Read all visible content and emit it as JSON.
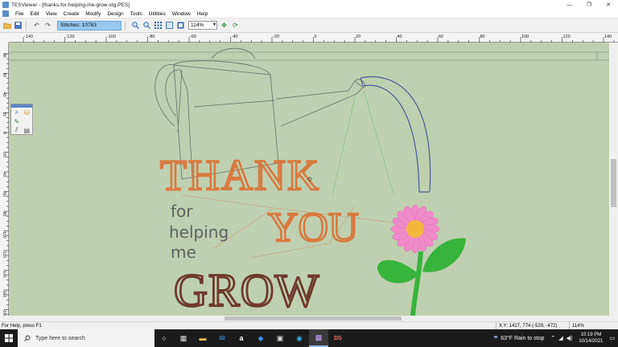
{
  "window": {
    "title": "TESViewer - [thanks-for-helping-me-grow-xtg.PES]",
    "controls": [
      "—",
      "❐",
      "✕"
    ]
  },
  "menu": [
    "File",
    "Edit",
    "View",
    "Create",
    "Modify",
    "Design",
    "Tools",
    "Utilities",
    "Window",
    "Help"
  ],
  "toolbar": {
    "stitches": "Stitches: 10783",
    "zoom": "114%"
  },
  "rulers": {
    "h_ticks": [
      "-140",
      "-120",
      "-100",
      "-80",
      "-60",
      "-40",
      "-20",
      "0",
      "20",
      "40",
      "60",
      "80",
      "100",
      "120",
      "140"
    ],
    "v_ticks": [
      "80",
      "60",
      "40",
      "20",
      "0",
      "-20",
      "-40",
      "-60",
      "-80",
      "-100",
      "-120",
      "-140",
      "-160",
      "-180",
      "-200"
    ]
  },
  "design": {
    "line1": "THANK",
    "line2": "for",
    "line3": "helping",
    "line4": "me",
    "line5": "YOU",
    "line6": "GROW",
    "colors": {
      "orange": "#d9793f",
      "gray": "#5e6160",
      "brown": "#6e3a2a",
      "pink": "#f08ac8",
      "center": "#f3b83a",
      "green": "#37b43b",
      "outline": "#6d7b72",
      "blue": "#3e4f9a",
      "canvas": "#bfd0b0"
    }
  },
  "status": {
    "help": "For Help, press F1",
    "coords": "X,Y: 1417, 774  (-529, -472)",
    "zoom": "114%"
  },
  "taskbar": {
    "search_placeholder": "Type here to search",
    "weather": "63°F  Rain to stop",
    "time": "10:19 PM",
    "date": "10/14/2021"
  }
}
